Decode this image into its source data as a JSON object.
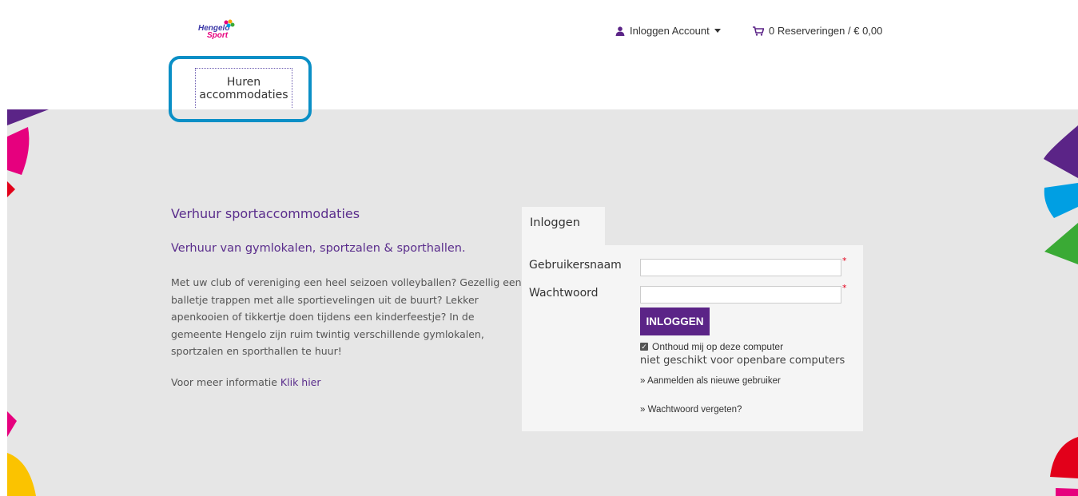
{
  "header": {
    "logo_line1": "Hengelo",
    "logo_line2": "Sport",
    "account_label": "Inloggen Account",
    "cart_label": "0 Reserveringen / € 0,00",
    "tab_label": "Huren accommodaties"
  },
  "intro": {
    "title": "Verhuur sportaccommodaties",
    "subtitle": "Verhuur van gymlokalen, sportzalen & sporthallen.",
    "body": "Met uw club of vereniging een heel seizoen volleyballen? Gezellig een balletje trappen met alle sportievelingen uit de buurt? Lekker apenkooien of tikkertje doen tijdens een kinderfeestje? In de gemeente Hengelo zijn ruim twintig verschillende gymlokalen, sportzalen en sporthallen te huur!",
    "more_info_text": "Voor meer informatie",
    "more_info_link": "Klik hier"
  },
  "login": {
    "tab_label": "Inloggen",
    "username_label": "Gebruikersnaam",
    "password_label": "Wachtwoord",
    "username_value": "",
    "password_value": "",
    "required_marker": "*",
    "submit_label": "INLOGGEN",
    "remember_label": "Onthoud mij op deze computer",
    "remember_checked": true,
    "not_public_text": "niet geschikt voor openbare computers",
    "register_link": "» Aanmelden als nieuwe gebruiker",
    "forgot_link": "» Wachtwoord vergeten?"
  },
  "colors": {
    "brand_purple": "#5b2487",
    "highlight_blue": "#0a8fc6",
    "background_grey": "#e6e6e6",
    "panel_grey": "#f5f5f5"
  },
  "icons": [
    "user-icon",
    "caret-down-icon",
    "cart-icon",
    "checkbox-checked-icon"
  ]
}
